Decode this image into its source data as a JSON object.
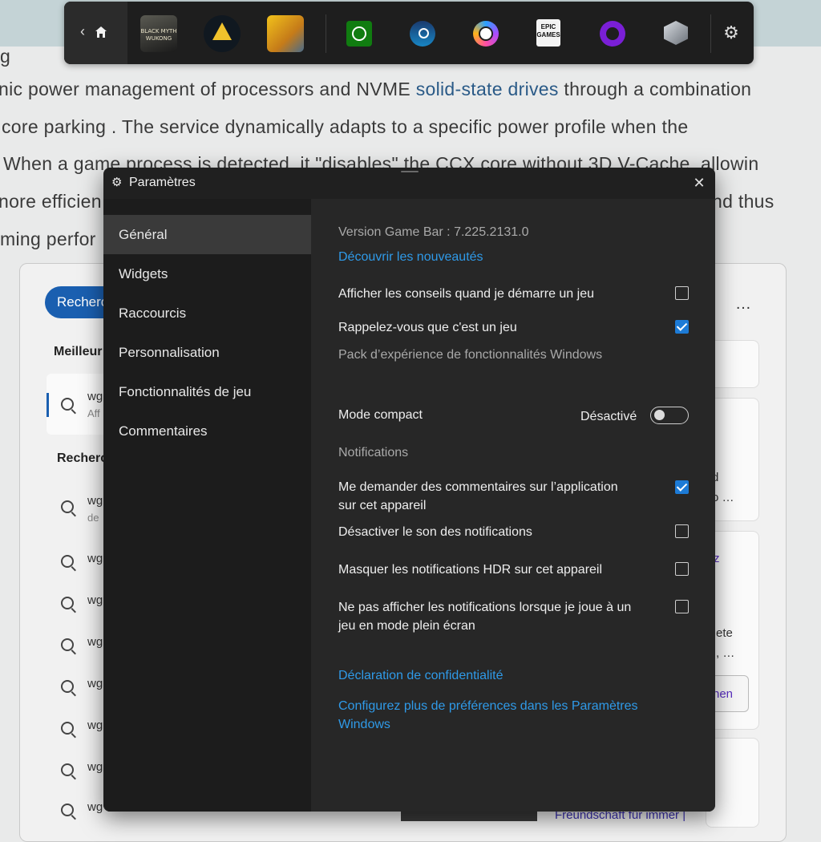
{
  "background_page": {
    "lines": [
      {
        "pre": "g",
        "link": "",
        "post": ""
      },
      {
        "pre": "nic power management of processors and NVME ",
        "link": "solid-state drives",
        "post": " through a combination"
      },
      {
        "pre": "core parking . The service dynamically adapts to a specific power profile when the",
        "link": "",
        "post": ""
      },
      {
        "pre": "When a game process is detected, it \"disables\" the CCX core without 3D V-Cache, allowin",
        "link": "",
        "post": ""
      },
      {
        "pre": "nore efficien",
        "link": "",
        "post": ""
      },
      {
        "pre": "ming perfor",
        "link": "",
        "post": ""
      }
    ],
    "line5_tail": "nd thus",
    "search_pill": "Recherc",
    "best_label": "Meilleur",
    "search_label": "Recherc",
    "best_item": {
      "title": "wg",
      "sub": "Aff"
    },
    "items": [
      {
        "title": "wg",
        "sub": "de"
      },
      {
        "title": "wg",
        "sub": ""
      },
      {
        "title": "wg",
        "sub": ""
      },
      {
        "title": "wg",
        "sub": ""
      },
      {
        "title": "wg",
        "sub": ""
      },
      {
        "title": "wg",
        "sub": ""
      },
      {
        "title": "wg",
        "sub": ""
      },
      {
        "title": "wg",
        "sub": ""
      }
    ],
    "more_dots": "…",
    "frag_d": "d",
    "frag_o": "o …",
    "frag_z": "z",
    "frag_ete": "ete",
    "frag_dots": ", …",
    "frag_nen": "nen",
    "frag_bottom": "Freundschaft für immer |"
  },
  "gamebar": {
    "back_icon": "chevron-left-icon",
    "home_icon": "home-icon",
    "wukong_text": "BLACK MYTH WUKONG",
    "epic_text": "EPIC GAMES",
    "settings_icon": "gear-icon"
  },
  "settings": {
    "title": "Paramètres",
    "nav": [
      "Général",
      "Widgets",
      "Raccourcis",
      "Personnalisation",
      "Fonctionnalités de jeu",
      "Commentaires"
    ],
    "active_nav": "Général",
    "version": "Version Game Bar : 7.225.2131.0",
    "whats_new": "Découvrir les nouveautés",
    "show_tips": {
      "label": "Afficher les conseils quand je démarre un jeu",
      "checked": false
    },
    "remember_game": {
      "label": "Rappelez-vous que c'est un jeu",
      "checked": true
    },
    "experience_pack": "Pack d’expérience de fonctionnalités Windows",
    "compact_mode": {
      "label": "Mode compact",
      "state": "Désactivé",
      "on": false
    },
    "notifications_heading": "Notifications",
    "ask_feedback": {
      "label_1": "Me demander des commentaires sur l’application",
      "label_2": "sur cet appareil",
      "checked": true
    },
    "mute_notifications": {
      "label": "Désactiver le son des notifications",
      "checked": false
    },
    "hide_hdr": {
      "label": "Masquer les notifications HDR sur cet appareil",
      "checked": false
    },
    "no_fullscreen_notif": {
      "label_1": "Ne pas afficher les notifications lorsque je joue à un",
      "label_2": "jeu en mode plein écran",
      "checked": false
    },
    "privacy": "Déclaration de confidentialité",
    "more_prefs_1": "Configurez plus de préférences dans les Paramètres",
    "more_prefs_2": "Windows"
  }
}
